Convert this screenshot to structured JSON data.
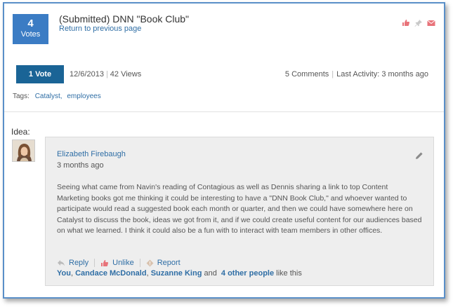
{
  "header": {
    "vote_count": "4",
    "vote_label": "Votes",
    "title": "(Submitted) DNN \"Book Club\"",
    "back_link": "Return to previous page",
    "icons": [
      "like-icon",
      "pin-icon",
      "mail-icon"
    ],
    "icon_color": "#e8737a"
  },
  "stats": {
    "vote_button": "1 Vote",
    "date": "12/6/2013",
    "views": "42 Views",
    "comments": "5 Comments",
    "last_activity": "Last Activity: 3 months ago"
  },
  "tags": {
    "label": "Tags:",
    "items": [
      "Catalyst,",
      "employees"
    ]
  },
  "idea": {
    "label": "Idea:",
    "author": "Elizabeth Firebaugh",
    "time": "3 months ago",
    "body": "Seeing what came from Navin's reading of Contagious as well as Dennis sharing a link to top Content Marketing books got me thinking it could be interesting to have a \"DNN Book Club,\" and whoever wanted to participate would read a suggested book each month or quarter, and then we could have somewhere here on Catalyst to discuss the book, ideas we got from it, and if we could create useful content for our audiences based on what we learned. I think it could also be a fun with to interact with team members in other offices.",
    "actions": {
      "reply": "Reply",
      "unlike": "Unlike",
      "report": "Report"
    },
    "likers": {
      "names": [
        "You",
        "Candace McDonald",
        "Suzanne King"
      ],
      "and": "and",
      "others": "4 other people",
      "suffix": "like this"
    }
  },
  "colors": {
    "accent": "#3b7cc4",
    "vote_button": "#1a6496",
    "link": "#2f6ea5",
    "frame_border": "#5a8fc8"
  }
}
